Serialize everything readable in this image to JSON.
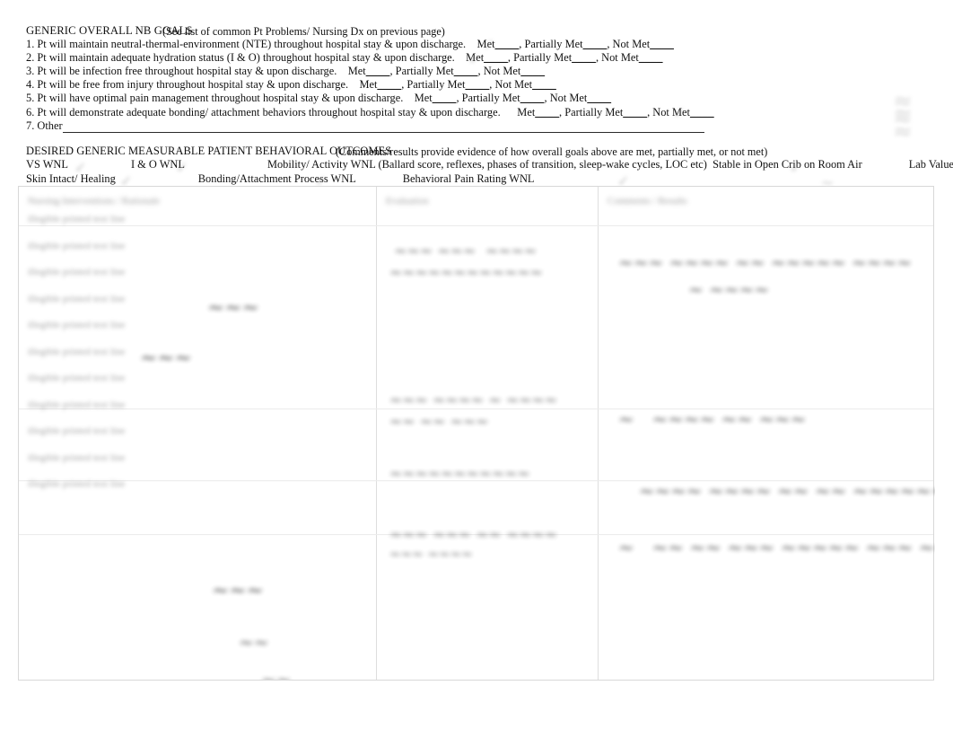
{
  "document": {
    "kind": "scanned-nursing-care-plan-form",
    "page_background": "#ffffff",
    "text_color": "#111111"
  },
  "goals": {
    "heading_main": "GENERIC OVERALL NB GOALS",
    "heading_parenthetical": "(See list of common Pt Problems/ Nursing Dx on previous page)",
    "met_label": "Met",
    "partially_met_label": "Partially Met",
    "not_met_label": "Not Met",
    "blank": "____",
    "items": [
      {
        "number": "1.",
        "text": "Pt will maintain neutral-thermal-environment (NTE) throughout hospital stay & upon discharge.",
        "has_outcome_blanks": true
      },
      {
        "number": "2.",
        "text": "Pt will maintain adequate hydration status (I & O) throughout hospital stay & upon discharge.",
        "has_outcome_blanks": true
      },
      {
        "number": "3.",
        "text": "Pt will be infection free throughout hospital stay & upon discharge.",
        "has_outcome_blanks": true
      },
      {
        "number": "4.",
        "text": "Pt will be free from injury throughout hospital stay & upon discharge.",
        "has_outcome_blanks": true
      },
      {
        "number": "5.",
        "text": "Pt will have optimal pain management throughout hospital stay & upon discharge.",
        "has_outcome_blanks": true
      },
      {
        "number": "6.",
        "text": "Pt will demonstrate adequate bonding/ attachment behaviors throughout hospital stay & upon discharge.",
        "has_outcome_blanks": true
      },
      {
        "number": "7.",
        "text": "Other",
        "has_outcome_blanks": false
      }
    ]
  },
  "outcomes": {
    "heading_main": "DESIRED GENERIC MEASURABLE PATIENT BEHAVIORAL OUTCOMES",
    "heading_parenthetical": "(Comments/results provide evidence of how overall goals above are met, partially met, or not met)",
    "row1": [
      "VS WNL",
      "I & O WNL",
      "Mobility/ Activity WNL (Ballard score, reflexes, phases of transition, sleep-wake cycles, LOC etc)",
      "Stable in Open Crib on Room Air",
      "Lab Values WNL"
    ],
    "row2": [
      "Skin Intact/ Healing",
      "Bonding/Attachment Process WNL",
      "Behavioral Pain Rating WNL"
    ]
  },
  "care_table": {
    "columns": [
      {
        "id": "col-1",
        "header": "Nursing Interventions / Rationale",
        "legible": false
      },
      {
        "id": "col-2",
        "header": "Evaluation",
        "legible": false
      },
      {
        "id": "col-3",
        "header": "Comments / Results",
        "legible": false
      }
    ],
    "note": "Table body content is obscured/illegible in the scan",
    "col1_lines": [
      "illegible printed text line",
      "illegible printed text line",
      "illegible printed text line",
      "illegible printed text line",
      "illegible printed text line",
      "illegible printed text line",
      "illegible printed text line",
      "illegible printed text line",
      "illegible printed text line",
      "illegible printed text line",
      "illegible printed text line"
    ],
    "col2_entries": [
      "handwritten entry (illegible)",
      "handwritten entry (illegible)",
      "handwritten entry (illegible)",
      "handwritten entry (illegible)"
    ],
    "col3_entries": [
      "handwritten entry (illegible)",
      "handwritten entry (illegible)",
      "handwritten entry (illegible)",
      "handwritten entry (illegible)"
    ]
  },
  "ink_marks": {
    "description": "faint handwritten checkmarks and annotations over the form",
    "glyph_check": "✓",
    "glyph_scribble": "~"
  }
}
